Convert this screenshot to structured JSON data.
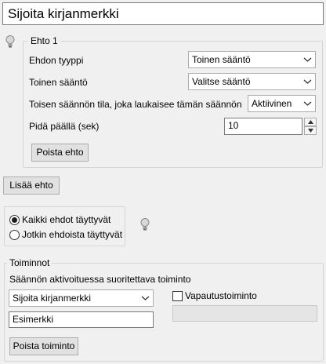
{
  "title": "Sijoita kirjanmerkki",
  "condition": {
    "group_title": "Ehto 1",
    "type_label": "Ehdon tyyppi",
    "type_value": "Toinen sääntö",
    "rule_label": "Toinen sääntö",
    "rule_value": "Valitse sääntö",
    "state_label": "Toisen säännön tila, joka laukaisee tämän säännön",
    "state_value": "Aktiivinen",
    "hold_label": "Pidä päällä (sek)",
    "hold_value": "10",
    "remove_label": "Poista ehto"
  },
  "add_condition_label": "Lisää ehto",
  "match": {
    "all_label": "Kaikki ehdot täyttyvät",
    "any_label": "Jotkin ehdoista täyttyvät",
    "selected": "all"
  },
  "actions": {
    "group_title": "Toiminnot",
    "subtitle": "Säännön aktivoituessa suoritettava toiminto",
    "action_value": "Sijoita kirjanmerkki",
    "release_label": "Vapautustoiminto",
    "release_checked": false,
    "name_value": "Esimerkki",
    "release_value": "",
    "remove_label": "Poista toiminto"
  },
  "icons": {
    "hint": "lightbulb-icon",
    "dropdown": "chevron-down-icon",
    "spin_up": "arrow-up-icon",
    "spin_down": "arrow-down-icon"
  }
}
